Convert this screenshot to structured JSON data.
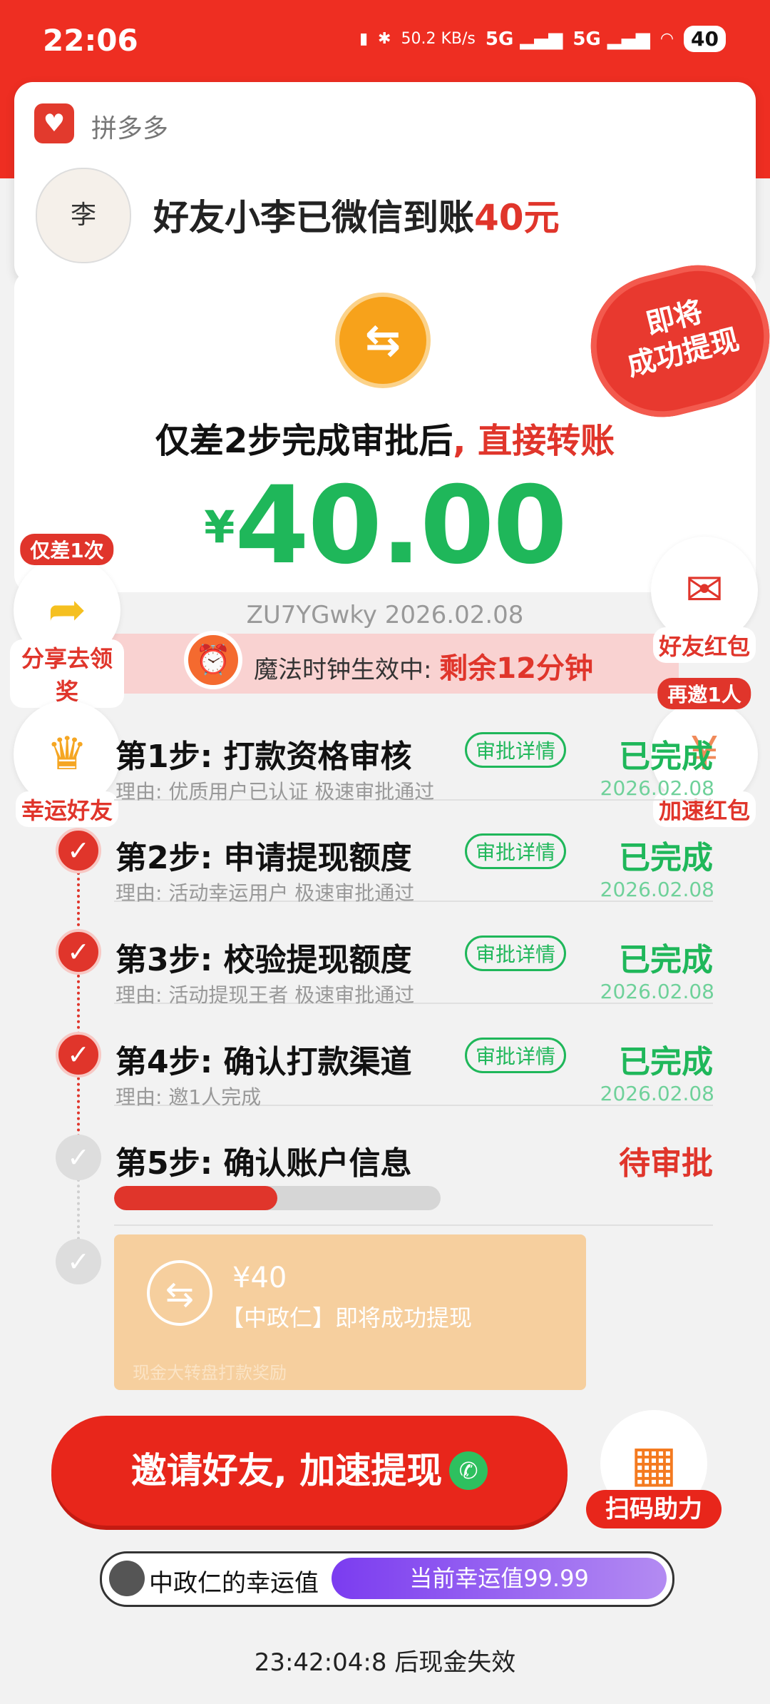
{
  "status_bar": {
    "time": "22:06",
    "speed": "50.2 KB/s",
    "sig1": "5G",
    "sig2": "5G",
    "battery": "40"
  },
  "notification": {
    "app_name": "拼多多",
    "message_prefix": "好友小李已微信到账",
    "message_amount": "40元"
  },
  "seal": {
    "line1": "即将",
    "line2": "成功提现"
  },
  "headline": {
    "prefix": "仅差2步完成审批后",
    "suffix": ", 直接转账"
  },
  "amount": {
    "currency": "¥",
    "value": "40.00"
  },
  "order": "ZU7YGwky 2026.02.08",
  "clock": {
    "prefix": "魔法时钟生效中:",
    "remaining": "剩余12分钟"
  },
  "floats": {
    "share": {
      "badge": "仅差1次",
      "label": "分享去领奖"
    },
    "friend_red": {
      "label": "好友红包"
    },
    "lucky_friend": {
      "label": "幸运好友"
    },
    "speed_red": {
      "badge": "再邀1人",
      "label": "加速红包"
    }
  },
  "steps": [
    {
      "title": "第1步: 打款资格审核",
      "detail": "审批详情",
      "status": "已完成",
      "reason": "理由: 优质用户已认证 极速审批通过",
      "date": "2026.02.08"
    },
    {
      "title": "第2步: 申请提现额度",
      "detail": "审批详情",
      "status": "已完成",
      "reason": "理由: 活动幸运用户 极速审批通过",
      "date": "2026.02.08"
    },
    {
      "title": "第3步: 校验提现额度",
      "detail": "审批详情",
      "status": "已完成",
      "reason": "理由: 活动提现王者 极速审批通过",
      "date": "2026.02.08"
    },
    {
      "title": "第4步: 确认打款渠道",
      "detail": "审批详情",
      "status": "已完成",
      "reason": "理由: 邀1人完成",
      "date": "2026.02.08"
    },
    {
      "title": "第5步: 确认账户信息",
      "status": "待审批",
      "progress": 0.5
    }
  ],
  "payout": {
    "amount": "¥40",
    "text": "【中政仁】即将成功提现",
    "footer": "现金大转盘打款奖励"
  },
  "invite_button": "邀请好友, 加速提现",
  "scan": {
    "label": "扫码助力"
  },
  "luck": {
    "name": "中政仁的幸运值",
    "value": "当前幸运值99.99"
  },
  "expire": "23:42:04:8 后现金失效",
  "colors": {
    "accent": "#e0352b",
    "green": "#1fb75a",
    "orange": "#f6cf9e",
    "purple": "#7b3cf0"
  }
}
